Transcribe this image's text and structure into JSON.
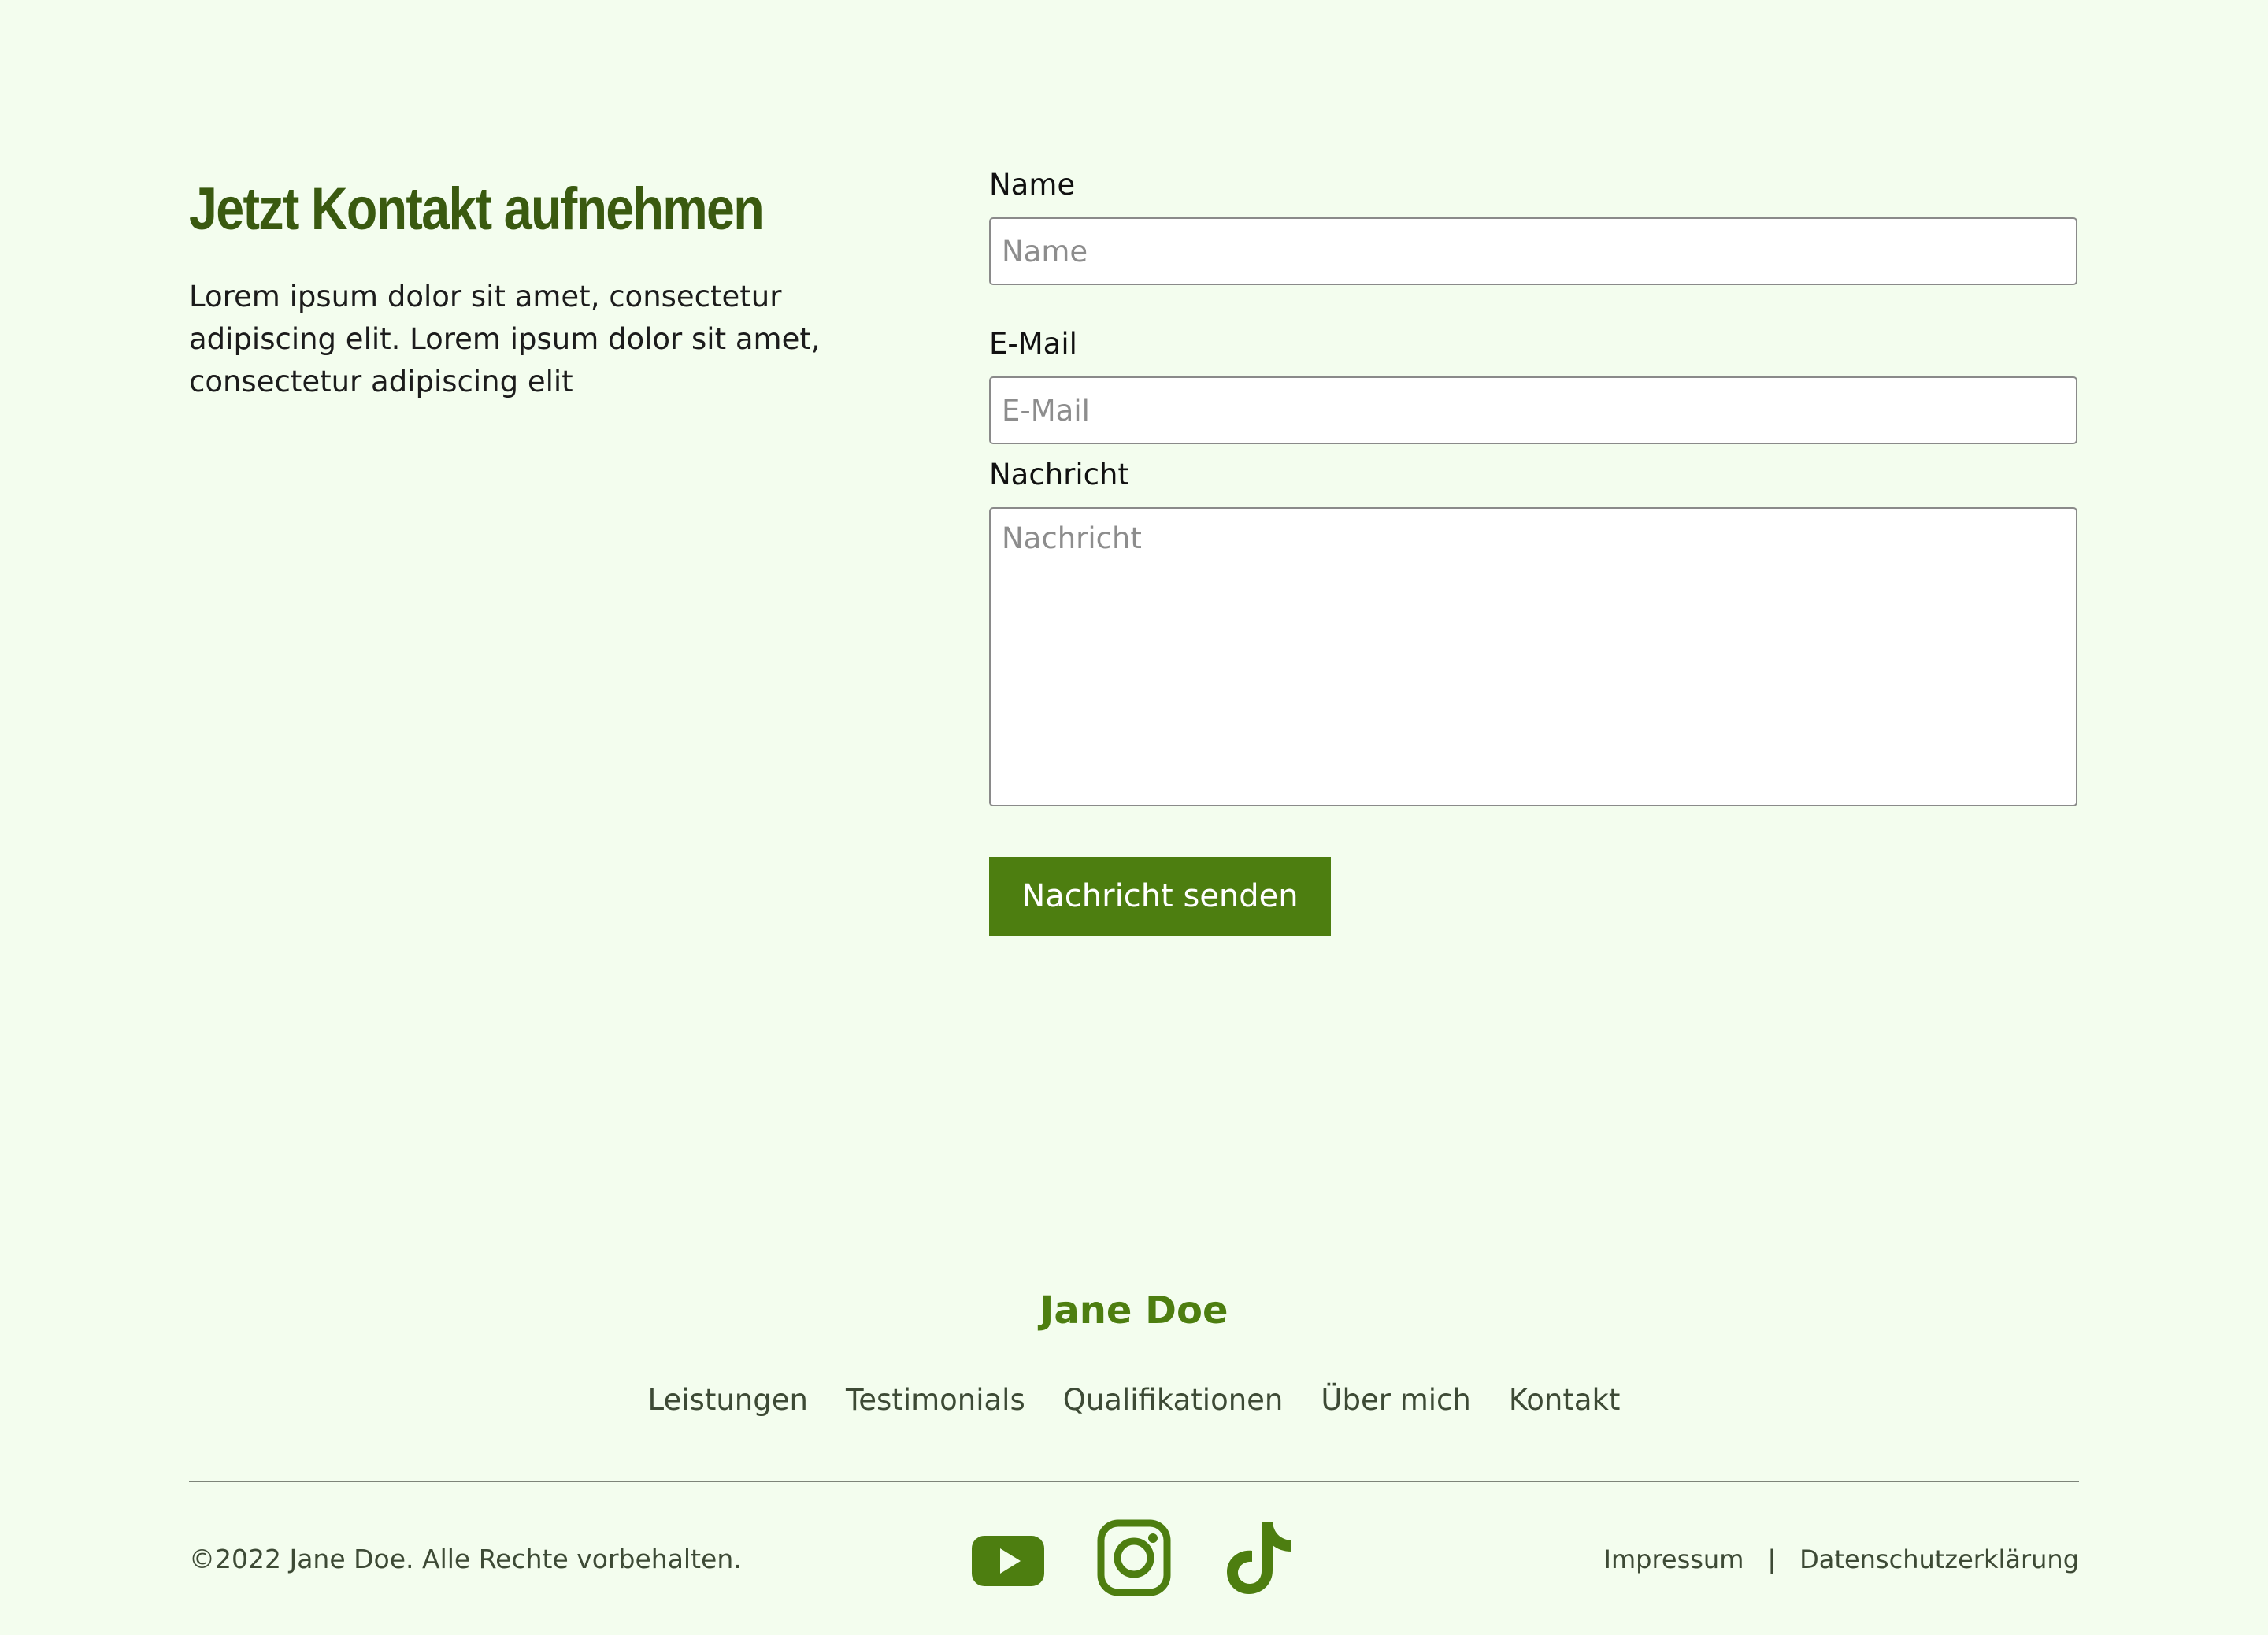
{
  "contact": {
    "title": "Jetzt Kontakt aufnehmen",
    "text": "Lorem ipsum dolor sit amet, consectetur adipiscing elit.  Lorem ipsum dolor sit amet, consectetur adipiscing elit"
  },
  "form": {
    "name_label": "Name",
    "name_placeholder": "Name",
    "email_label": "E-Mail",
    "email_placeholder": "E-Mail",
    "message_label": "Nachricht",
    "message_placeholder": "Nachricht",
    "submit_label": "Nachricht senden"
  },
  "footer": {
    "brand": "Jane Doe",
    "nav": [
      "Leistungen",
      "Testimonials",
      "Qualifikationen",
      "Über mich",
      "Kontakt"
    ],
    "copyright": "©2022 Jane Doe. Alle Rechte vorbehalten.",
    "social": [
      "youtube-icon",
      "instagram-icon",
      "tiktok-icon"
    ],
    "legal": {
      "impressum": "Impressum",
      "separator": "|",
      "privacy": "Datenschutzerklärung"
    }
  },
  "colors": {
    "background": "#f3fdee",
    "accent": "#4d7e10",
    "heading": "#3a5a10",
    "footer_text": "#3d4a35"
  }
}
